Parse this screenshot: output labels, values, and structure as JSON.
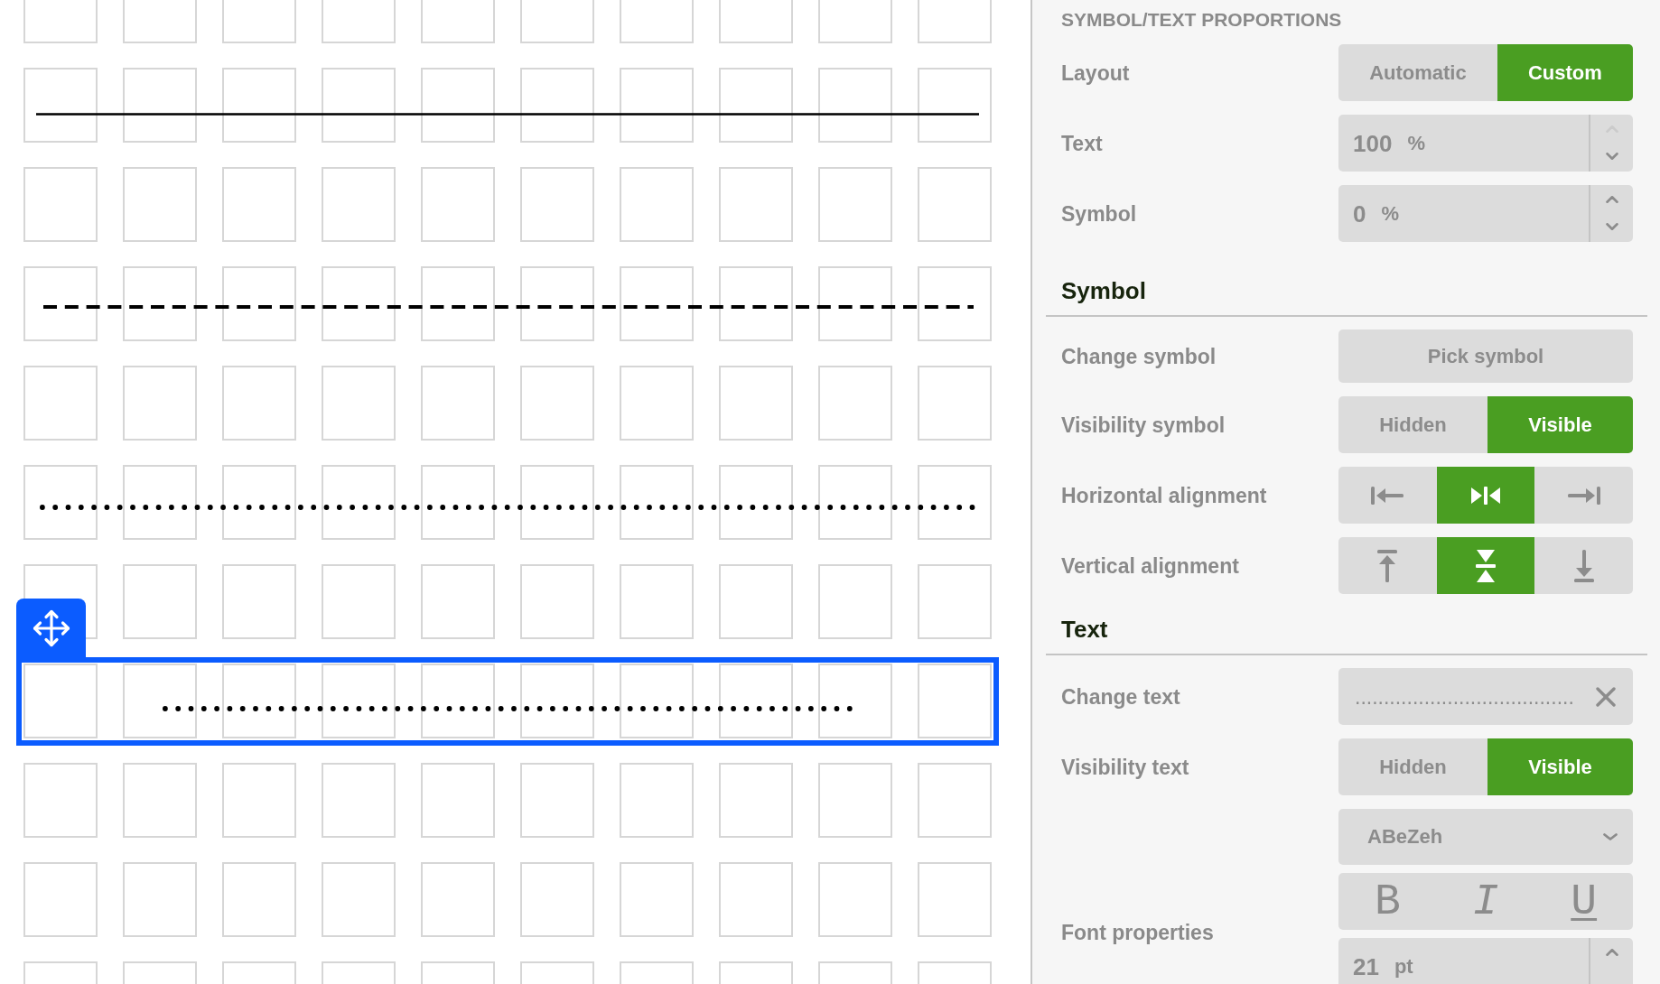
{
  "worksheet": {
    "rows": [
      {
        "kind": "blank",
        "selected": false
      },
      {
        "kind": "solid",
        "selected": false
      },
      {
        "kind": "blank",
        "selected": false
      },
      {
        "kind": "dashed",
        "selected": false
      },
      {
        "kind": "blank",
        "selected": false
      },
      {
        "kind": "dotted",
        "selected": false
      },
      {
        "kind": "blank",
        "selected": false
      },
      {
        "kind": "centered",
        "selected": true
      },
      {
        "kind": "blank",
        "selected": false
      },
      {
        "kind": "blank",
        "selected": false
      },
      {
        "kind": "blank",
        "selected": false
      }
    ]
  },
  "panel": {
    "sections": [
      {
        "kind": "group",
        "heading": "SYMBOL/TEXT PROPORTIONS",
        "rows": [
          {
            "kind": "toggle",
            "label": "Layout",
            "options": [
              {
                "label": "Automatic",
                "selected": false
              },
              {
                "label": "Custom",
                "selected": true
              }
            ]
          },
          {
            "kind": "spinner",
            "label": "Text",
            "value": "100",
            "unit": "%",
            "up_disabled": true
          },
          {
            "kind": "spinner",
            "label": "Symbol",
            "value": "0",
            "unit": "%",
            "up_disabled": false
          }
        ]
      },
      {
        "kind": "section",
        "heading": "Symbol",
        "rows": [
          {
            "kind": "button",
            "label": "Change symbol",
            "button": "Pick symbol"
          },
          {
            "kind": "toggle",
            "label": "Visibility symbol",
            "options": [
              {
                "label": "Hidden",
                "selected": false
              },
              {
                "label": "Visible",
                "selected": true
              }
            ]
          },
          {
            "kind": "align",
            "label": "Horizontal alignment",
            "options": [
              {
                "kind": "left",
                "selected": false
              },
              {
                "kind": "center",
                "selected": true
              },
              {
                "kind": "right",
                "selected": false
              }
            ]
          },
          {
            "kind": "align",
            "label": "Vertical alignment",
            "options": [
              {
                "kind": "top",
                "selected": false
              },
              {
                "kind": "middle",
                "selected": true
              },
              {
                "kind": "bottom",
                "selected": false
              }
            ]
          }
        ]
      },
      {
        "kind": "section",
        "heading": "Text",
        "rows": [
          {
            "kind": "textfield",
            "label": "Change text",
            "value": "......................................"
          },
          {
            "kind": "toggle",
            "label": "Visibility text",
            "options": [
              {
                "label": "Hidden",
                "selected": false
              },
              {
                "label": "Visible",
                "selected": true
              }
            ]
          },
          {
            "kind": "font",
            "label": "Font properties",
            "font": "ABeZeh",
            "styles": [
              {
                "kind": "bold",
                "label": "B",
                "selected": false
              },
              {
                "kind": "italic",
                "label": "I",
                "selected": false
              },
              {
                "kind": "underline",
                "label": "U",
                "selected": false
              }
            ],
            "size": {
              "value": "21",
              "unit": "pt",
              "up_disabled": false
            }
          }
        ]
      }
    ]
  }
}
